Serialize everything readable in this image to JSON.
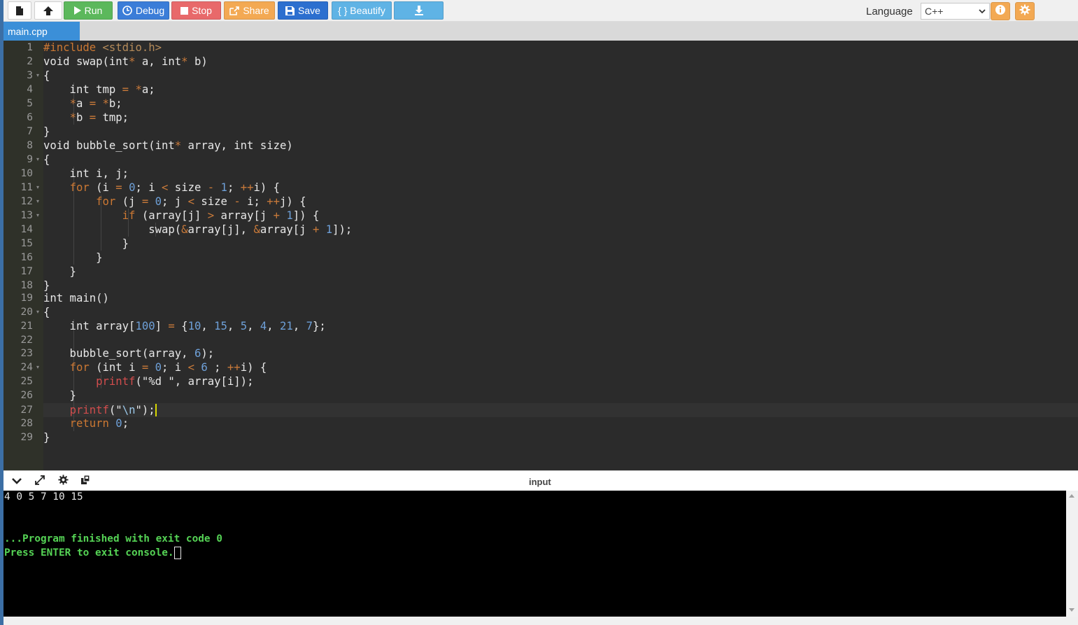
{
  "toolbar": {
    "new_file_icon": "file-icon",
    "upload_icon": "upload-icon",
    "run_label": "Run",
    "debug_label": "Debug",
    "stop_label": "Stop",
    "share_label": "Share",
    "save_label": "Save",
    "beautify_label": "{ } Beautify",
    "download_icon": "download-icon",
    "language_label": "Language",
    "language_selected": "C++",
    "info_icon": "info-icon",
    "settings_icon": "gear-icon"
  },
  "colors": {
    "run": "#5cb85c",
    "debug": "#3b7dd8",
    "stop": "#e8696a",
    "share": "#f3a953",
    "save": "#2c6fcf",
    "beautify": "#5fb3e5",
    "tab": "#3b8fd8",
    "editor_bg": "#2b2b2b",
    "terminal_bg": "#000000",
    "terminal_green": "#55d355"
  },
  "tabs": [
    {
      "label": "main.cpp",
      "active": true
    }
  ],
  "editor": {
    "line_numbers": [
      "1",
      "2",
      "3",
      "4",
      "5",
      "6",
      "7",
      "8",
      "9",
      "10",
      "11",
      "12",
      "13",
      "14",
      "15",
      "16",
      "17",
      "18",
      "19",
      "20",
      "21",
      "22",
      "23",
      "24",
      "25",
      "26",
      "27",
      "28",
      "29"
    ],
    "fold_markers": [
      3,
      9,
      11,
      12,
      13,
      20,
      24
    ],
    "active_line": 27
  },
  "console": {
    "collapse_icon": "chevron-down-icon",
    "expand_icon": "expand-icon",
    "settings_icon": "gear-icon",
    "copy_icon": "copy-icon",
    "input_label": "input",
    "output_lines": [
      "4 0 5 7 10 15",
      "",
      "",
      "...Program finished with exit code 0",
      "Press ENTER to exit console."
    ]
  }
}
